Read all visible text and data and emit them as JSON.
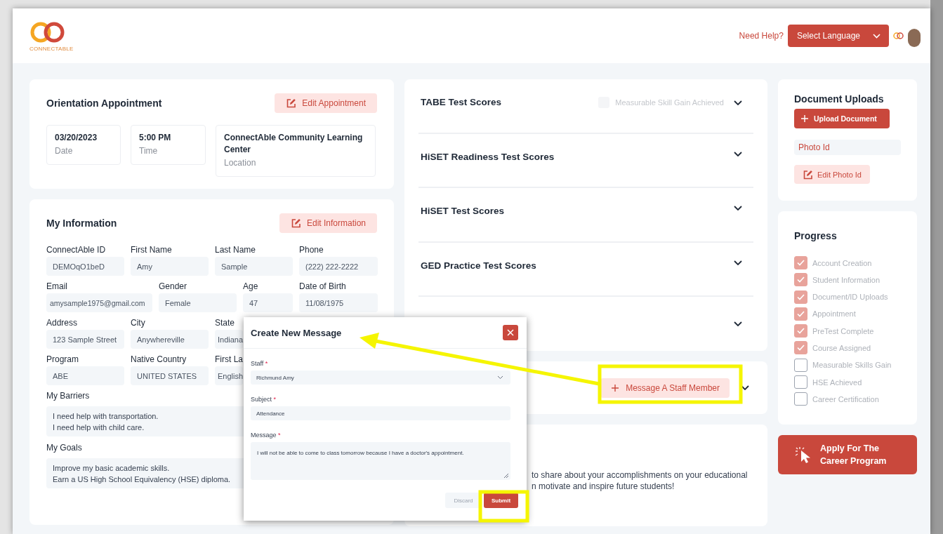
{
  "header": {
    "logo_text": "CONNECTABLE",
    "help_link": "Need Help?",
    "language_select": "Select Language"
  },
  "appointment": {
    "title": "Orientation Appointment",
    "edit_button": "Edit Appointment",
    "details": [
      {
        "value": "03/20/2023",
        "label": "Date"
      },
      {
        "value": "5:00 PM",
        "label": "Time"
      },
      {
        "value": "ConnectAble Community Learning Center",
        "label": "Location"
      }
    ]
  },
  "my_information": {
    "title": "My Information",
    "edit_button": "Edit Information",
    "rows": [
      [
        {
          "label": "ConnectAble ID",
          "value": "DEMOqO1beD"
        },
        {
          "label": "First Name",
          "value": "Amy"
        },
        {
          "label": "Last Name",
          "value": "Sample"
        },
        {
          "label": "Phone",
          "value": "(222) 222-2222"
        }
      ],
      [
        {
          "label": "Email",
          "value": "amysample1975@gmail.com"
        },
        {
          "label": "Gender",
          "value": "Female"
        },
        {
          "label": "Age",
          "value": "47"
        },
        {
          "label": "Date of Birth",
          "value": "11/08/1975"
        }
      ],
      [
        {
          "label": "Address",
          "value": "123 Sample Street"
        },
        {
          "label": "City",
          "value": "Anywhereville"
        },
        {
          "label": "State",
          "value": "Indiana"
        }
      ],
      [
        {
          "label": "Program",
          "value": "ABE"
        },
        {
          "label": "Native Country",
          "value": "UNITED STATES"
        },
        {
          "label": "First La",
          "value": "English"
        }
      ]
    ],
    "barriers": {
      "label": "My Barriers",
      "lines": [
        "I need help with transportation.",
        "I need help with child care."
      ]
    },
    "goals": {
      "label": "My Goals",
      "lines": [
        "Improve my basic academic skills.",
        "Earn a US High School Equivalency (HSE) diploma."
      ]
    }
  },
  "test_scores": {
    "sections": [
      {
        "title": "TABE Test Scores",
        "expanded": false,
        "skill_gain": {
          "label": "Measurable Skill Gain Achieved",
          "checked": false
        }
      },
      {
        "title": "HiSET Readiness Test Scores",
        "expanded": false
      },
      {
        "title": "HiSET Test Scores",
        "expanded": false
      },
      {
        "title": "GED Practice Test Scores",
        "expanded": false
      },
      {
        "expanded": false
      }
    ]
  },
  "staff_message": {
    "button": "Message A Staff Member",
    "expanded": false
  },
  "share_card": {
    "lines": [
      "to share about your accomplishments on your educational",
      "n motivate and inspire future students!"
    ]
  },
  "documents": {
    "title": "Document Uploads",
    "upload_button": "Upload Document",
    "files": [
      {
        "name": "Photo Id",
        "edit_button": "Edit Photo Id"
      }
    ]
  },
  "progress": {
    "title": "Progress",
    "steps": [
      {
        "label": "Account Creation",
        "checked": true
      },
      {
        "label": "Student Information",
        "checked": true
      },
      {
        "label": "Document/ID Uploads",
        "checked": true
      },
      {
        "label": "Appointment",
        "checked": true
      },
      {
        "label": "PreTest Complete",
        "checked": true
      },
      {
        "label": "Course Assigned",
        "checked": true
      },
      {
        "label": "Measurable Skills Gain",
        "checked": false
      },
      {
        "label": "HSE Achieved",
        "checked": false
      },
      {
        "label": "Career Certification",
        "checked": false
      }
    ]
  },
  "apply_button": "Apply For The Career Program",
  "modal": {
    "title": "Create New Message",
    "fields": [
      {
        "kind": "select",
        "label": "Staff",
        "mark": "*",
        "value": "Richmund Amy"
      },
      {
        "kind": "input",
        "label": "Subject",
        "mark": "*",
        "value": "Attendance"
      },
      {
        "kind": "textarea",
        "label": "Message",
        "mark": "*",
        "value": "I will not be able to come to class tomorrow because I have a doctor's appointment."
      }
    ],
    "discard_button": "Discard",
    "submit_button": "Submit"
  }
}
